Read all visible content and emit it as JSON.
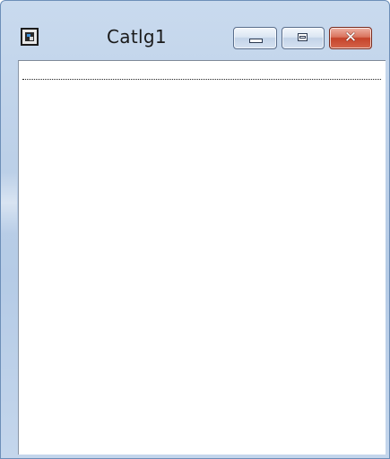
{
  "window": {
    "title": "Catlg1",
    "icon": "app-window-icon",
    "controls": {
      "minimize_icon": "minimize-icon",
      "maximize_icon": "maximize-icon",
      "close_icon": "close-icon",
      "close_glyph": "✕"
    },
    "frame_color": "#bcd0e8",
    "close_color": "#c5432a"
  },
  "list": {
    "items": [
      ""
    ]
  }
}
